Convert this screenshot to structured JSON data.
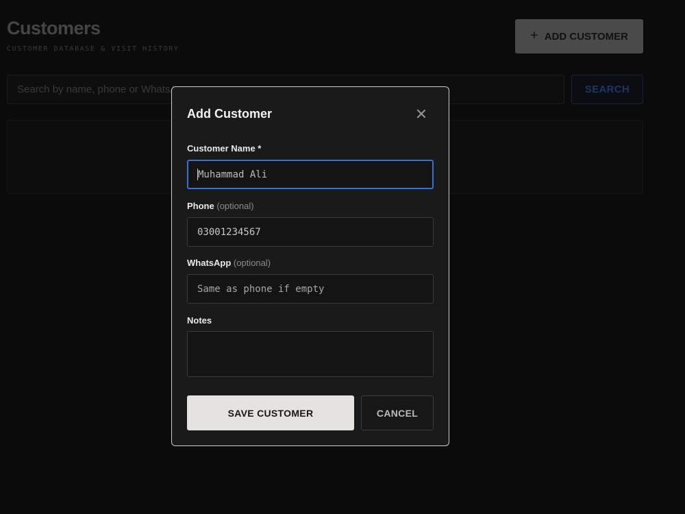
{
  "page": {
    "title": "Customers",
    "subtitle": "CUSTOMER DATABASE & VISIT HISTORY",
    "add_button": {
      "icon": "plus-icon",
      "label": "ADD CUSTOMER"
    },
    "search": {
      "placeholder": "Search by name, phone or WhatsApp",
      "button_label": "SEARCH"
    }
  },
  "modal": {
    "title": "Add Customer",
    "close_icon": "close-icon",
    "fields": {
      "name": {
        "label": "Customer Name *",
        "value": "Muhammad Ali"
      },
      "phone": {
        "label": "Phone",
        "optional": "(optional)",
        "value": "03001234567"
      },
      "whatsapp": {
        "label": "WhatsApp",
        "optional": "(optional)",
        "placeholder": "Same as phone if empty"
      },
      "notes": {
        "label": "Notes",
        "value": ""
      }
    },
    "save_label": "SAVE CUSTOMER",
    "cancel_label": "CANCEL"
  },
  "colors": {
    "focus_border": "#3b6fd4",
    "save_button_bg": "#e6e2df",
    "modal_bg": "#1a1a1a"
  }
}
